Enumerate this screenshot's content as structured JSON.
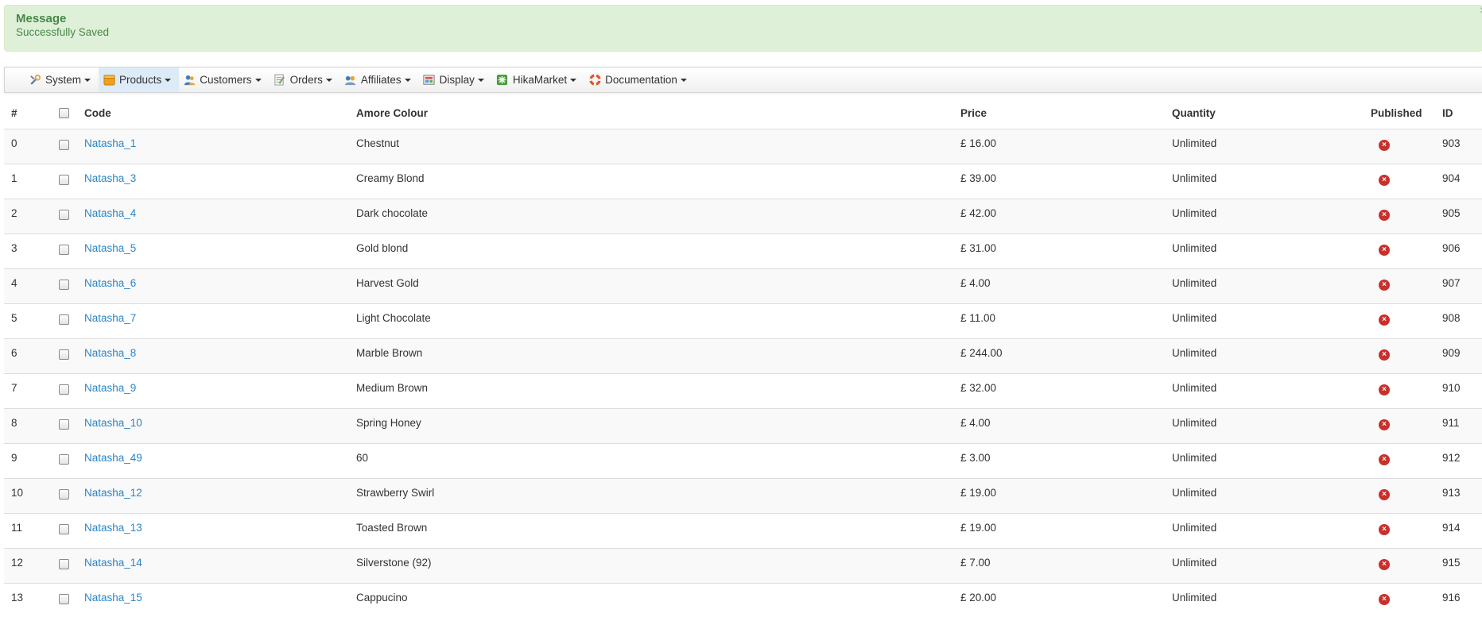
{
  "alert": {
    "heading": "Message",
    "text": "Successfully Saved",
    "close": "×"
  },
  "menu": [
    {
      "label": "System",
      "icon": "tools-icon"
    },
    {
      "label": "Products",
      "icon": "products-box-icon",
      "active": true
    },
    {
      "label": "Customers",
      "icon": "customers-icon"
    },
    {
      "label": "Orders",
      "icon": "orders-icon"
    },
    {
      "label": "Affiliates",
      "icon": "affiliates-icon"
    },
    {
      "label": "Display",
      "icon": "display-icon"
    },
    {
      "label": "HikaMarket",
      "icon": "hikamarket-icon"
    },
    {
      "label": "Documentation",
      "icon": "lifebuoy-icon"
    }
  ],
  "table": {
    "headers": {
      "num": "#",
      "code": "Code",
      "colour": "Amore Colour",
      "price": "Price",
      "quantity": "Quantity",
      "published": "Published",
      "id": "ID"
    },
    "rows": [
      {
        "num": "0",
        "code": "Natasha_1",
        "colour": "Chestnut",
        "price": "£ 16.00",
        "quantity": "Unlimited",
        "published": "×",
        "id": "903"
      },
      {
        "num": "1",
        "code": "Natasha_3",
        "colour": "Creamy Blond",
        "price": "£ 39.00",
        "quantity": "Unlimited",
        "published": "×",
        "id": "904"
      },
      {
        "num": "2",
        "code": "Natasha_4",
        "colour": "Dark chocolate",
        "price": "£ 42.00",
        "quantity": "Unlimited",
        "published": "×",
        "id": "905"
      },
      {
        "num": "3",
        "code": "Natasha_5",
        "colour": "Gold blond",
        "price": "£ 31.00",
        "quantity": "Unlimited",
        "published": "×",
        "id": "906"
      },
      {
        "num": "4",
        "code": "Natasha_6",
        "colour": "Harvest Gold",
        "price": "£ 4.00",
        "quantity": "Unlimited",
        "published": "×",
        "id": "907"
      },
      {
        "num": "5",
        "code": "Natasha_7",
        "colour": "Light Chocolate",
        "price": "£ 11.00",
        "quantity": "Unlimited",
        "published": "×",
        "id": "908"
      },
      {
        "num": "6",
        "code": "Natasha_8",
        "colour": "Marble Brown",
        "price": "£ 244.00",
        "quantity": "Unlimited",
        "published": "×",
        "id": "909"
      },
      {
        "num": "7",
        "code": "Natasha_9",
        "colour": "Medium Brown",
        "price": "£ 32.00",
        "quantity": "Unlimited",
        "published": "×",
        "id": "910"
      },
      {
        "num": "8",
        "code": "Natasha_10",
        "colour": "Spring Honey",
        "price": "£ 4.00",
        "quantity": "Unlimited",
        "published": "×",
        "id": "911"
      },
      {
        "num": "9",
        "code": "Natasha_49",
        "colour": "60",
        "price": "£ 3.00",
        "quantity": "Unlimited",
        "published": "×",
        "id": "912"
      },
      {
        "num": "10",
        "code": "Natasha_12",
        "colour": "Strawberry Swirl",
        "price": "£ 19.00",
        "quantity": "Unlimited",
        "published": "×",
        "id": "913"
      },
      {
        "num": "11",
        "code": "Natasha_13",
        "colour": "Toasted Brown",
        "price": "£ 19.00",
        "quantity": "Unlimited",
        "published": "×",
        "id": "914"
      },
      {
        "num": "12",
        "code": "Natasha_14",
        "colour": "Silverstone (92)",
        "price": "£ 7.00",
        "quantity": "Unlimited",
        "published": "×",
        "id": "915"
      },
      {
        "num": "13",
        "code": "Natasha_15",
        "colour": "Cappucino",
        "price": "£ 20.00",
        "quantity": "Unlimited",
        "published": "×",
        "id": "916"
      }
    ]
  }
}
